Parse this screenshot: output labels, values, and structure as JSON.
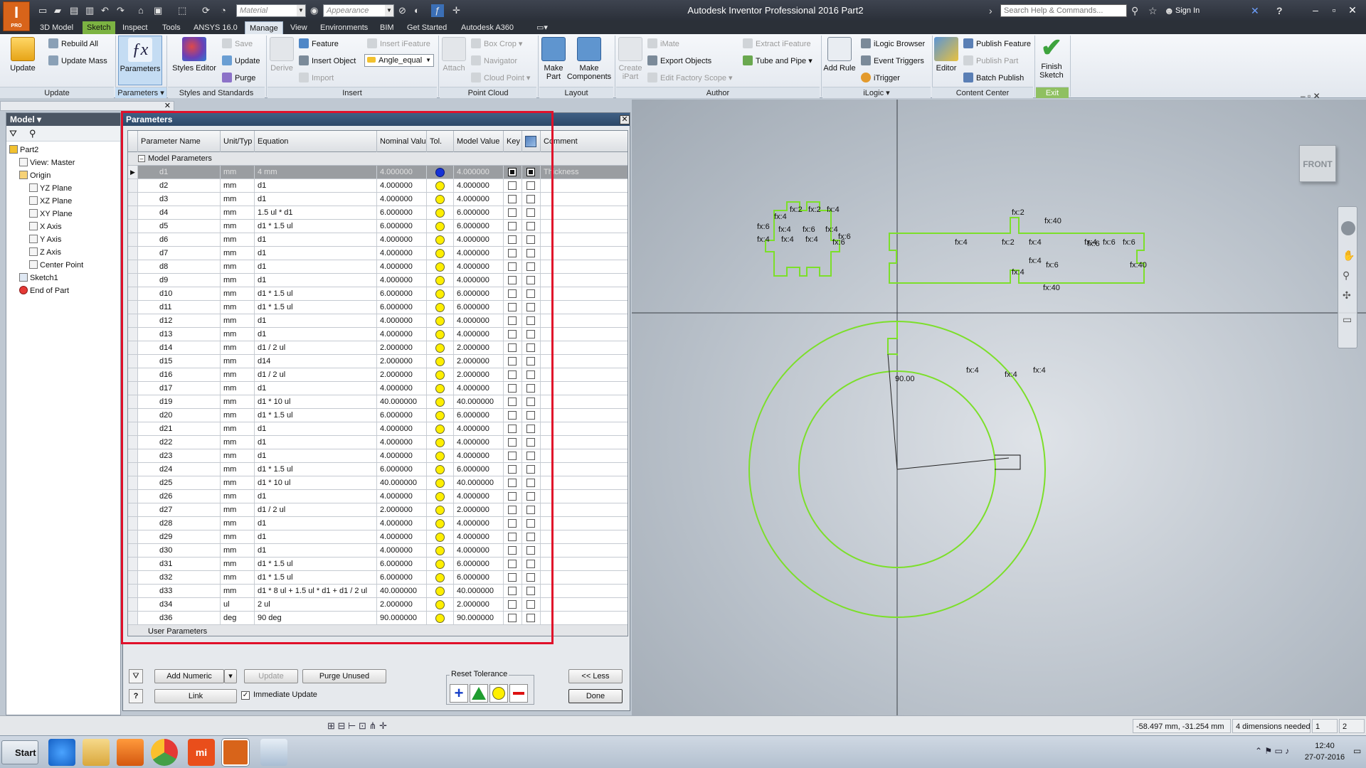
{
  "window": {
    "title": "Autodesk Inventor Professional 2016   Part2",
    "logo_text": "I",
    "logo_sub": "PRO",
    "material_combo": "Material",
    "appearance_combo": "Appearance",
    "help_search_placeholder": "Search Help & Commands...",
    "signin": "Sign In"
  },
  "tabs": [
    "3D Model",
    "Sketch",
    "Inspect",
    "Tools",
    "ANSYS 16.0",
    "Manage",
    "View",
    "Environments",
    "BIM",
    "Get Started",
    "Autodesk A360"
  ],
  "active_tab": "Manage",
  "ribbon": {
    "update_panel": {
      "big": "Update",
      "items": [
        "Rebuild All",
        "Update Mass"
      ],
      "label": "Update"
    },
    "parameters_panel": {
      "big": "Parameters",
      "label": "Parameters"
    },
    "styles_panel": {
      "big": "Styles Editor",
      "items": [
        "Save",
        "Update",
        "Purge"
      ],
      "label": "Styles and Standards"
    },
    "insert_panel": {
      "derive": "Derive",
      "items": [
        "Feature",
        "Insert Object",
        "Import"
      ],
      "ifeature": "Insert iFeature",
      "angle_combo": "Angle_equal",
      "label": "Insert"
    },
    "pointcloud_panel": {
      "attach": "Attach",
      "items": [
        "Box Crop",
        "Navigator",
        "Cloud Point"
      ],
      "label": "Point Cloud"
    },
    "layout_panel": {
      "items": [
        "Make Part",
        "Make Components"
      ],
      "label": "Layout"
    },
    "author_panel": {
      "create_ipart": "Create iPart",
      "items": [
        "iMate",
        "Export Objects",
        "Edit Factory Scope"
      ],
      "items2": [
        "Extract iFeature",
        "Tube and Pipe"
      ],
      "label": "Author"
    },
    "ilogic_panel": {
      "add_rule": "Add Rule",
      "items": [
        "iLogic Browser",
        "Event Triggers",
        "iTrigger"
      ],
      "label": "iLogic"
    },
    "content_panel": {
      "editor": "Editor",
      "items": [
        "Publish Feature",
        "Publish Part",
        "Batch Publish"
      ],
      "label": "Content Center"
    },
    "exit_panel": {
      "finish": "Finish Sketch",
      "label": "Exit"
    }
  },
  "model_browser": {
    "header": "Model",
    "items": [
      {
        "label": "Part2",
        "indent": 0
      },
      {
        "label": "View: Master",
        "indent": 1
      },
      {
        "label": "Origin",
        "indent": 1
      },
      {
        "label": "YZ Plane",
        "indent": 2
      },
      {
        "label": "XZ Plane",
        "indent": 2
      },
      {
        "label": "XY Plane",
        "indent": 2
      },
      {
        "label": "X Axis",
        "indent": 2
      },
      {
        "label": "Y Axis",
        "indent": 2
      },
      {
        "label": "Z Axis",
        "indent": 2
      },
      {
        "label": "Center Point",
        "indent": 2
      },
      {
        "label": "Sketch1",
        "indent": 1
      },
      {
        "label": "End of Part",
        "indent": 1
      }
    ]
  },
  "parameters_dialog": {
    "title": "Parameters",
    "columns": [
      "Parameter Name",
      "Unit/Typ",
      "Equation",
      "Nominal Valu",
      "Tol.",
      "Model Value",
      "Key",
      "",
      "Comment"
    ],
    "group_model": "Model Parameters",
    "group_user": "User Parameters",
    "rows": [
      {
        "name": "d1",
        "unit": "mm",
        "eq": "4 mm",
        "nom": "4.000000",
        "model": "4.000000",
        "comment": "Thickness",
        "tol": "blue"
      },
      {
        "name": "d2",
        "unit": "mm",
        "eq": "d1",
        "nom": "4.000000",
        "model": "4.000000",
        "comment": ""
      },
      {
        "name": "d3",
        "unit": "mm",
        "eq": "d1",
        "nom": "4.000000",
        "model": "4.000000",
        "comment": ""
      },
      {
        "name": "d4",
        "unit": "mm",
        "eq": "1.5 ul * d1",
        "nom": "6.000000",
        "model": "6.000000",
        "comment": ""
      },
      {
        "name": "d5",
        "unit": "mm",
        "eq": "d1 * 1.5 ul",
        "nom": "6.000000",
        "model": "6.000000",
        "comment": ""
      },
      {
        "name": "d6",
        "unit": "mm",
        "eq": "d1",
        "nom": "4.000000",
        "model": "4.000000",
        "comment": ""
      },
      {
        "name": "d7",
        "unit": "mm",
        "eq": "d1",
        "nom": "4.000000",
        "model": "4.000000",
        "comment": ""
      },
      {
        "name": "d8",
        "unit": "mm",
        "eq": "d1",
        "nom": "4.000000",
        "model": "4.000000",
        "comment": ""
      },
      {
        "name": "d9",
        "unit": "mm",
        "eq": "d1",
        "nom": "4.000000",
        "model": "4.000000",
        "comment": ""
      },
      {
        "name": "d10",
        "unit": "mm",
        "eq": "d1 * 1.5 ul",
        "nom": "6.000000",
        "model": "6.000000",
        "comment": ""
      },
      {
        "name": "d11",
        "unit": "mm",
        "eq": "d1 * 1.5 ul",
        "nom": "6.000000",
        "model": "6.000000",
        "comment": ""
      },
      {
        "name": "d12",
        "unit": "mm",
        "eq": "d1",
        "nom": "4.000000",
        "model": "4.000000",
        "comment": ""
      },
      {
        "name": "d13",
        "unit": "mm",
        "eq": "d1",
        "nom": "4.000000",
        "model": "4.000000",
        "comment": ""
      },
      {
        "name": "d14",
        "unit": "mm",
        "eq": "d1 / 2 ul",
        "nom": "2.000000",
        "model": "2.000000",
        "comment": ""
      },
      {
        "name": "d15",
        "unit": "mm",
        "eq": "d14",
        "nom": "2.000000",
        "model": "2.000000",
        "comment": ""
      },
      {
        "name": "d16",
        "unit": "mm",
        "eq": "d1 / 2 ul",
        "nom": "2.000000",
        "model": "2.000000",
        "comment": ""
      },
      {
        "name": "d17",
        "unit": "mm",
        "eq": "d1",
        "nom": "4.000000",
        "model": "4.000000",
        "comment": ""
      },
      {
        "name": "d19",
        "unit": "mm",
        "eq": "d1 * 10 ul",
        "nom": "40.000000",
        "model": "40.000000",
        "comment": ""
      },
      {
        "name": "d20",
        "unit": "mm",
        "eq": "d1 * 1.5 ul",
        "nom": "6.000000",
        "model": "6.000000",
        "comment": ""
      },
      {
        "name": "d21",
        "unit": "mm",
        "eq": "d1",
        "nom": "4.000000",
        "model": "4.000000",
        "comment": ""
      },
      {
        "name": "d22",
        "unit": "mm",
        "eq": "d1",
        "nom": "4.000000",
        "model": "4.000000",
        "comment": ""
      },
      {
        "name": "d23",
        "unit": "mm",
        "eq": "d1",
        "nom": "4.000000",
        "model": "4.000000",
        "comment": ""
      },
      {
        "name": "d24",
        "unit": "mm",
        "eq": "d1 * 1.5 ul",
        "nom": "6.000000",
        "model": "6.000000",
        "comment": ""
      },
      {
        "name": "d25",
        "unit": "mm",
        "eq": "d1 * 10 ul",
        "nom": "40.000000",
        "model": "40.000000",
        "comment": ""
      },
      {
        "name": "d26",
        "unit": "mm",
        "eq": "d1",
        "nom": "4.000000",
        "model": "4.000000",
        "comment": ""
      },
      {
        "name": "d27",
        "unit": "mm",
        "eq": "d1 / 2 ul",
        "nom": "2.000000",
        "model": "2.000000",
        "comment": ""
      },
      {
        "name": "d28",
        "unit": "mm",
        "eq": "d1",
        "nom": "4.000000",
        "model": "4.000000",
        "comment": ""
      },
      {
        "name": "d29",
        "unit": "mm",
        "eq": "d1",
        "nom": "4.000000",
        "model": "4.000000",
        "comment": ""
      },
      {
        "name": "d30",
        "unit": "mm",
        "eq": "d1",
        "nom": "4.000000",
        "model": "4.000000",
        "comment": ""
      },
      {
        "name": "d31",
        "unit": "mm",
        "eq": "d1 * 1.5 ul",
        "nom": "6.000000",
        "model": "6.000000",
        "comment": ""
      },
      {
        "name": "d32",
        "unit": "mm",
        "eq": "d1 * 1.5 ul",
        "nom": "6.000000",
        "model": "6.000000",
        "comment": ""
      },
      {
        "name": "d33",
        "unit": "mm",
        "eq": "d1 * 8 ul + 1.5 ul * d1 + d1 / 2 ul",
        "nom": "40.000000",
        "model": "40.000000",
        "comment": ""
      },
      {
        "name": "d34",
        "unit": "ul",
        "eq": "2 ul",
        "nom": "2.000000",
        "model": "2.000000",
        "comment": ""
      },
      {
        "name": "d36",
        "unit": "deg",
        "eq": "90 deg",
        "nom": "90.000000",
        "model": "90.000000",
        "comment": ""
      }
    ],
    "buttons": {
      "add_numeric": "Add Numeric",
      "update": "Update",
      "purge_unused": "Purge Unused",
      "link": "Link",
      "immediate_update": "Immediate Update",
      "reset_tolerance": "Reset Tolerance",
      "less": "<< Less",
      "done": "Done"
    },
    "immediate_update_checked": true
  },
  "viewport": {
    "viewcube_label": "FRONT",
    "dimensions": [
      "fx:2",
      "fx:40",
      "fx:4",
      "fx:2",
      "fx:2",
      "fx:4",
      "fx:4",
      "fx:6",
      "fx:4",
      "fx:6",
      "fx:4",
      "fx:4",
      "fx:4",
      "fx:4",
      "fx:6",
      "fx:6",
      "fx:4",
      "fx:2",
      "fx:4",
      "fx:4",
      "fx:6",
      "fx:4",
      "fx:6",
      "fx:40",
      "fx:6",
      "fx:6",
      "fx:40",
      "90.00",
      "fx:4",
      "fx:4",
      "fx:4"
    ],
    "sketch_color": "#7cdf2a"
  },
  "status": {
    "coords": "-58.497 mm, -31.254 mm",
    "dims_needed": "4 dimensions needed",
    "field1": "1",
    "field2": "2"
  },
  "taskbar": {
    "start": "Start",
    "time": "12:40",
    "date": "27-07-2016"
  }
}
